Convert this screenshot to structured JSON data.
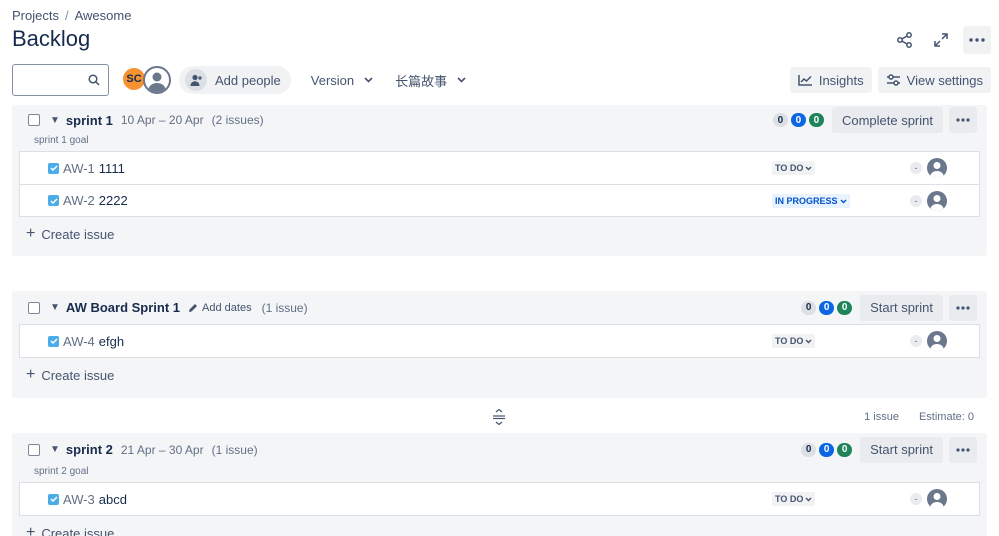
{
  "breadcrumb": {
    "projects": "Projects",
    "separator": "/",
    "project": "Awesome"
  },
  "page": {
    "title": "Backlog"
  },
  "toolbar": {
    "search_placeholder": "",
    "avatar_initials": "SC",
    "add_people": "Add people",
    "version": "Version",
    "epic": "长篇故事",
    "insights": "Insights",
    "view_settings": "View settings"
  },
  "sprints": [
    {
      "name": "sprint 1",
      "dates": "10 Apr – 20 Apr",
      "count": "(2 issues)",
      "goal": "sprint 1 goal",
      "pills": [
        "0",
        "0",
        "0"
      ],
      "action": "Complete sprint",
      "issues": [
        {
          "key": "AW-1",
          "summary": "1111",
          "status": "TO DO",
          "estimate": "-"
        },
        {
          "key": "AW-2",
          "summary": "2222",
          "status": "IN PROGRESS",
          "estimate": "-"
        }
      ],
      "create": "Create issue"
    },
    {
      "name": "AW Board Sprint 1",
      "add_dates": "Add dates",
      "count": "(1 issue)",
      "pills": [
        "0",
        "0",
        "0"
      ],
      "action": "Start sprint",
      "issues": [
        {
          "key": "AW-4",
          "summary": "efgh",
          "status": "TO DO",
          "estimate": "-"
        }
      ],
      "create": "Create issue"
    },
    {
      "name": "sprint 2",
      "dates": "21 Apr – 30 Apr",
      "count": "(1 issue)",
      "goal": "sprint 2 goal",
      "pills": [
        "0",
        "0",
        "0"
      ],
      "action": "Start sprint",
      "issues": [
        {
          "key": "AW-3",
          "summary": "abcd",
          "status": "TO DO",
          "estimate": "-"
        }
      ],
      "create": "Create issue"
    }
  ],
  "backlog_summary": {
    "issues": "1 issue",
    "estimate": "Estimate: 0"
  },
  "colors": {
    "accent_blue": "#0c66e4",
    "done_green": "#1f845a",
    "avatar_orange": "#f79232",
    "story_icon": "#4bade8"
  }
}
